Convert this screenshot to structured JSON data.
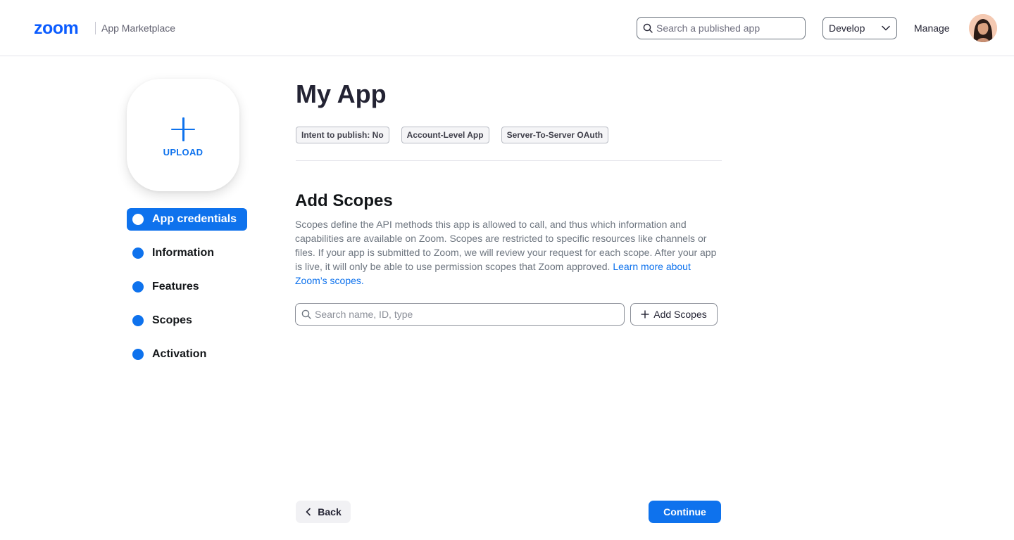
{
  "header": {
    "logo_text": "zoom",
    "marketplace_label": "App Marketplace",
    "search_placeholder": "Search a published app",
    "develop_label": "Develop",
    "manage_label": "Manage"
  },
  "sidebar": {
    "upload_label": "UPLOAD",
    "items": [
      {
        "label": "App credentials",
        "active": true
      },
      {
        "label": "Information",
        "active": false
      },
      {
        "label": "Features",
        "active": false
      },
      {
        "label": "Scopes",
        "active": false
      },
      {
        "label": "Activation",
        "active": false
      }
    ]
  },
  "main": {
    "title": "My App",
    "tags": [
      "Intent to publish: No",
      "Account-Level App",
      "Server-To-Server OAuth"
    ],
    "section_title": "Add Scopes",
    "description": "Scopes define the API methods this app is allowed to call, and thus which information and capabilities are available on Zoom. Scopes are restricted to specific resources like channels or files. If your app is submitted to Zoom, we will review your request for each scope. After your app is live, it will only be able to use permission scopes that Zoom approved.",
    "learn_more_link": "Learn more about Zoom’s scopes.",
    "scope_search_placeholder": "Search name, ID, type",
    "add_scopes_label": "Add Scopes"
  },
  "footer": {
    "back_label": "Back",
    "continue_label": "Continue"
  },
  "colors": {
    "brand": "#0b5cff",
    "primary": "#0e72ed",
    "text": "#232333",
    "muted": "#6e7680"
  },
  "icons": [
    "search-icon",
    "chevron-down-icon",
    "plus-icon",
    "chevron-left-icon"
  ]
}
